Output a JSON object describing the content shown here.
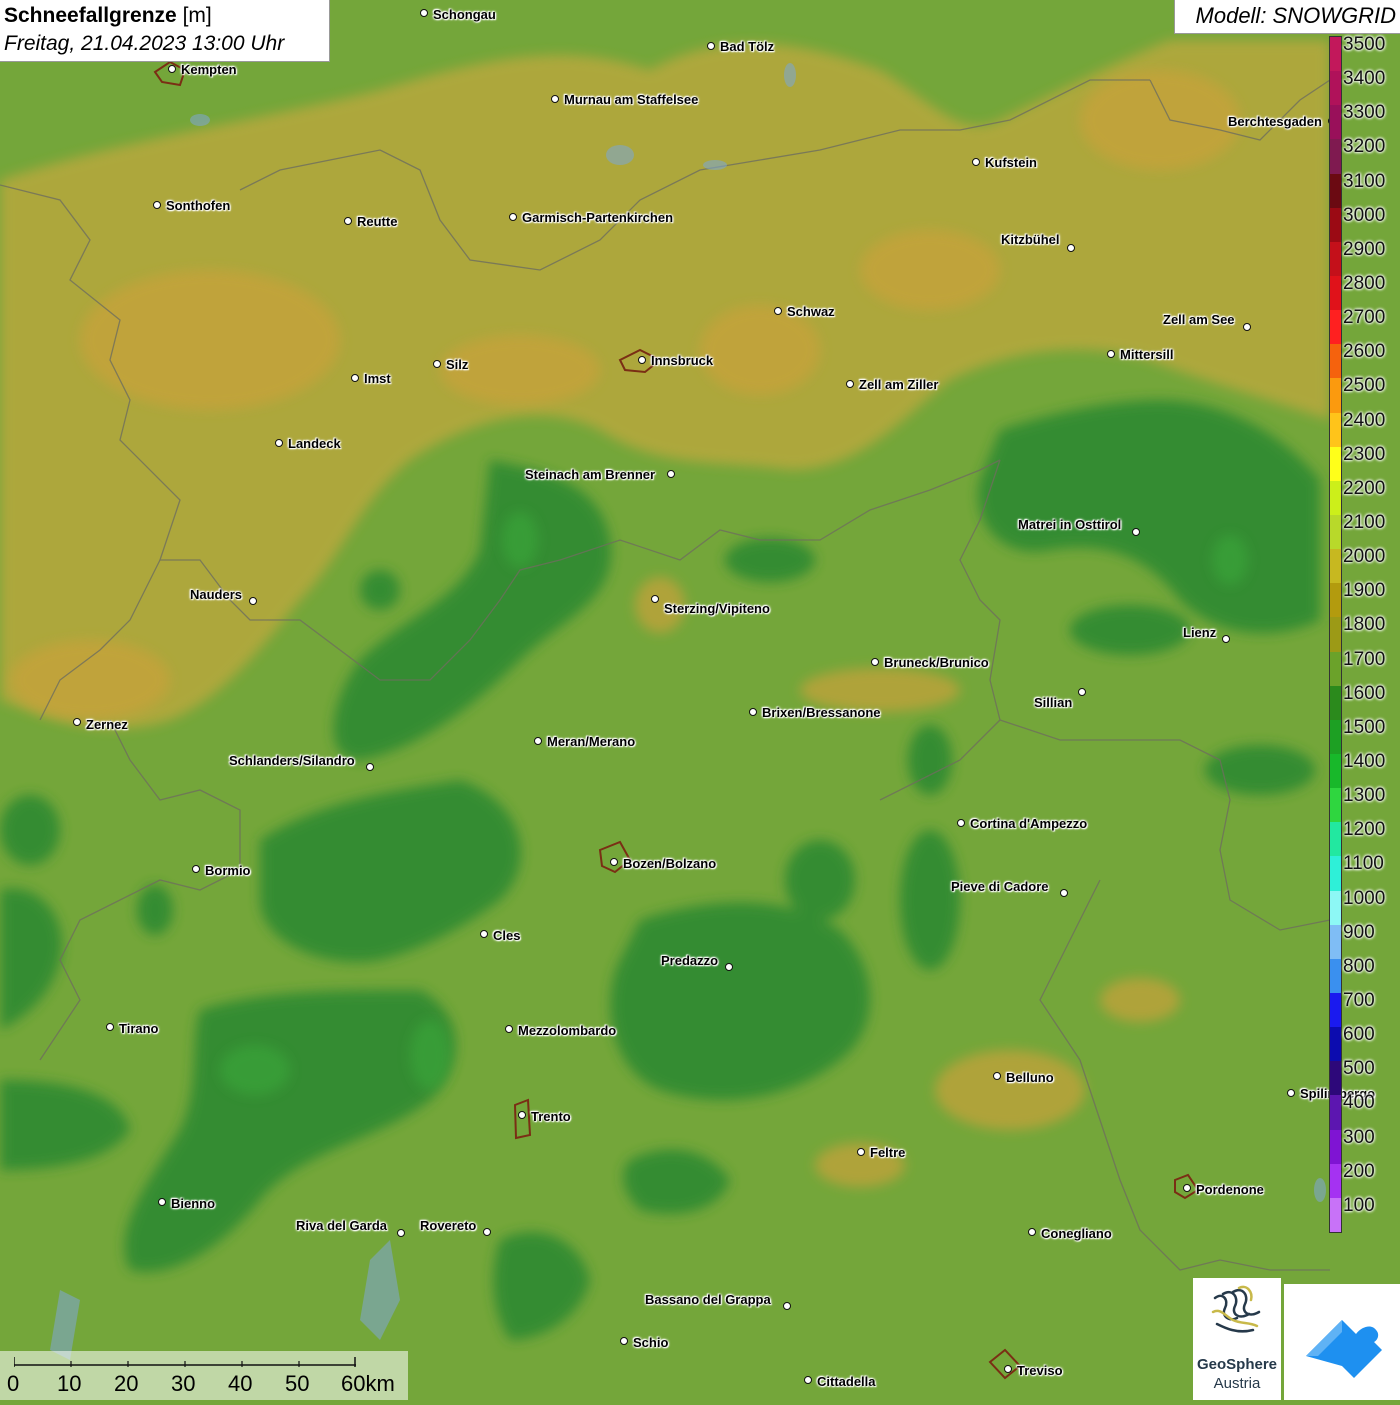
{
  "title": {
    "main": "Schneefallgrenze",
    "unit": "[m]",
    "date": "Freitag, 21.04.2023 13:00 Uhr"
  },
  "model": "Modell: SNOWGRID",
  "legend": {
    "labels": [
      "3500",
      "3400",
      "3300",
      "3200",
      "3100",
      "3000",
      "2900",
      "2800",
      "2700",
      "2600",
      "2500",
      "2400",
      "2300",
      "2200",
      "2100",
      "2000",
      "1900",
      "1800",
      "1700",
      "1600",
      "1500",
      "1400",
      "1300",
      "1200",
      "1100",
      "1000",
      "900",
      "800",
      "700",
      "600",
      "500",
      "400",
      "300",
      "200",
      "100"
    ],
    "colors": [
      "#c2185b",
      "#b0125a",
      "#99105a",
      "#7f1a50",
      "#6b0a12",
      "#9b0a14",
      "#c4101a",
      "#e0121a",
      "#ff2020",
      "#f5620d",
      "#fb9a0e",
      "#ffc41a",
      "#ffff1a",
      "#ccef1a",
      "#b8d92a",
      "#c7b820",
      "#b39b0e",
      "#9c9a16",
      "#6ba22a",
      "#2b8a1c",
      "#1da023",
      "#18b82a",
      "#2fd63f",
      "#22e8a0",
      "#2ef0d8",
      "#8df8f5",
      "#7fbdf5",
      "#3a90ef",
      "#1a1aef",
      "#0c0caf",
      "#2d087a",
      "#5c16b0",
      "#7f14d3",
      "#a532f2",
      "#c872f8"
    ]
  },
  "cities": [
    {
      "name": "Schongau",
      "dot": [
        424,
        13
      ],
      "label": [
        433,
        7
      ],
      "align": "left"
    },
    {
      "name": "Kempten",
      "dot": [
        172,
        69
      ],
      "label": [
        181,
        62
      ],
      "align": "left"
    },
    {
      "name": "Bad Tölz",
      "dot": [
        711,
        46
      ],
      "label": [
        720,
        39
      ],
      "align": "left"
    },
    {
      "name": "Murnau am Staffelsee",
      "dot": [
        555,
        99
      ],
      "label": [
        564,
        92
      ],
      "align": "left"
    },
    {
      "name": "Kufstein",
      "dot": [
        976,
        162
      ],
      "label": [
        985,
        155
      ],
      "align": "left"
    },
    {
      "name": "Berchtesgaden",
      "dot": [
        1332,
        121
      ],
      "label": [
        1228,
        114
      ],
      "align": "left"
    },
    {
      "name": "Sonthofen",
      "dot": [
        157,
        205
      ],
      "label": [
        166,
        198
      ],
      "align": "left"
    },
    {
      "name": "Reutte",
      "dot": [
        348,
        221
      ],
      "label": [
        357,
        214
      ],
      "align": "left"
    },
    {
      "name": "Garmisch-Partenkirchen",
      "dot": [
        513,
        217
      ],
      "label": [
        522,
        210
      ],
      "align": "left"
    },
    {
      "name": "Kitzbühel",
      "dot": [
        1071,
        248
      ],
      "label": [
        1001,
        232
      ],
      "align": "left"
    },
    {
      "name": "Schwaz",
      "dot": [
        778,
        311
      ],
      "label": [
        787,
        304
      ],
      "align": "left"
    },
    {
      "name": "Zell am See",
      "dot": [
        1247,
        327
      ],
      "label": [
        1163,
        312
      ],
      "align": "left"
    },
    {
      "name": "Innsbruck",
      "dot": [
        642,
        360
      ],
      "label": [
        651,
        353
      ],
      "align": "left"
    },
    {
      "name": "Mittersill",
      "dot": [
        1111,
        354
      ],
      "label": [
        1120,
        347
      ],
      "align": "left"
    },
    {
      "name": "Silz",
      "dot": [
        437,
        364
      ],
      "label": [
        446,
        357
      ],
      "align": "left"
    },
    {
      "name": "Imst",
      "dot": [
        355,
        378
      ],
      "label": [
        364,
        371
      ],
      "align": "left"
    },
    {
      "name": "Zell am Ziller",
      "dot": [
        850,
        384
      ],
      "label": [
        859,
        377
      ],
      "align": "left"
    },
    {
      "name": "Landeck",
      "dot": [
        279,
        443
      ],
      "label": [
        288,
        436
      ],
      "align": "left"
    },
    {
      "name": "Steinach am Brenner",
      "dot": [
        671,
        474
      ],
      "label": [
        525,
        467
      ],
      "align": "left"
    },
    {
      "name": "Matrei in Osttirol",
      "dot": [
        1136,
        532
      ],
      "label": [
        1018,
        517
      ],
      "align": "left"
    },
    {
      "name": "Nauders",
      "dot": [
        253,
        601
      ],
      "label": [
        190,
        587
      ],
      "align": "left"
    },
    {
      "name": "Sterzing/Vipiteno",
      "dot": [
        655,
        599
      ],
      "label": [
        664,
        601
      ],
      "align": "left"
    },
    {
      "name": "Lienz",
      "dot": [
        1226,
        639
      ],
      "label": [
        1183,
        625
      ],
      "align": "left"
    },
    {
      "name": "Bruneck/Brunico",
      "dot": [
        875,
        662
      ],
      "label": [
        884,
        655
      ],
      "align": "left"
    },
    {
      "name": "Sillian",
      "dot": [
        1082,
        692
      ],
      "label": [
        1034,
        695
      ],
      "align": "left"
    },
    {
      "name": "Brixen/Bressanone",
      "dot": [
        753,
        712
      ],
      "label": [
        762,
        705
      ],
      "align": "left"
    },
    {
      "name": "Zernez",
      "dot": [
        77,
        722
      ],
      "label": [
        86,
        717
      ],
      "align": "left"
    },
    {
      "name": "Meran/Merano",
      "dot": [
        538,
        741
      ],
      "label": [
        547,
        734
      ],
      "align": "left"
    },
    {
      "name": "Schlanders/Silandro",
      "dot": [
        370,
        767
      ],
      "label": [
        229,
        753
      ],
      "align": "left"
    },
    {
      "name": "Cortina d'Ampezzo",
      "dot": [
        961,
        823
      ],
      "label": [
        970,
        816
      ],
      "align": "left"
    },
    {
      "name": "Bozen/Bolzano",
      "dot": [
        614,
        862
      ],
      "label": [
        623,
        856
      ],
      "align": "left"
    },
    {
      "name": "Bormio",
      "dot": [
        196,
        869
      ],
      "label": [
        205,
        863
      ],
      "align": "left"
    },
    {
      "name": "Pieve di Cadore",
      "dot": [
        1064,
        893
      ],
      "label": [
        951,
        879
      ],
      "align": "left"
    },
    {
      "name": "Cles",
      "dot": [
        484,
        934
      ],
      "label": [
        493,
        928
      ],
      "align": "left"
    },
    {
      "name": "Predazzo",
      "dot": [
        729,
        967
      ],
      "label": [
        661,
        953
      ],
      "align": "left"
    },
    {
      "name": "Tirano",
      "dot": [
        110,
        1027
      ],
      "label": [
        119,
        1021
      ],
      "align": "left"
    },
    {
      "name": "Mezzolombardo",
      "dot": [
        509,
        1029
      ],
      "label": [
        518,
        1023
      ],
      "align": "left"
    },
    {
      "name": "Belluno",
      "dot": [
        997,
        1076
      ],
      "label": [
        1006,
        1070
      ],
      "align": "left"
    },
    {
      "name": "Spilimbergo",
      "dot": [
        1291,
        1093
      ],
      "label": [
        1300,
        1086
      ],
      "align": "left"
    },
    {
      "name": "Trento",
      "dot": [
        522,
        1115
      ],
      "label": [
        531,
        1109
      ],
      "align": "left"
    },
    {
      "name": "Feltre",
      "dot": [
        861,
        1152
      ],
      "label": [
        870,
        1145
      ],
      "align": "left"
    },
    {
      "name": "Pordenone",
      "dot": [
        1187,
        1188
      ],
      "label": [
        1196,
        1182
      ],
      "align": "left"
    },
    {
      "name": "Bienno",
      "dot": [
        162,
        1202
      ],
      "label": [
        171,
        1196
      ],
      "align": "left"
    },
    {
      "name": "Riva del Garda",
      "dot": [
        401,
        1233
      ],
      "label": [
        296,
        1218
      ],
      "align": "left"
    },
    {
      "name": "Rovereto",
      "dot": [
        487,
        1232
      ],
      "label": [
        420,
        1218
      ],
      "align": "left"
    },
    {
      "name": "Conegliano",
      "dot": [
        1032,
        1232
      ],
      "label": [
        1041,
        1226
      ],
      "align": "left"
    },
    {
      "name": "Bassano del Grappa",
      "dot": [
        787,
        1306
      ],
      "label": [
        645,
        1292
      ],
      "align": "left"
    },
    {
      "name": "Schio",
      "dot": [
        624,
        1341
      ],
      "label": [
        633,
        1335
      ],
      "align": "left"
    },
    {
      "name": "Treviso",
      "dot": [
        1008,
        1369
      ],
      "label": [
        1017,
        1363
      ],
      "align": "left"
    },
    {
      "name": "Cittadella",
      "dot": [
        808,
        1380
      ],
      "label": [
        817,
        1374
      ],
      "align": "left"
    }
  ],
  "scale": {
    "labels": [
      "0",
      "10",
      "20",
      "30",
      "40",
      "50",
      "60km"
    ]
  },
  "logos": {
    "geosphere_name": "GeoSphere",
    "geosphere_sub": "Austria"
  }
}
